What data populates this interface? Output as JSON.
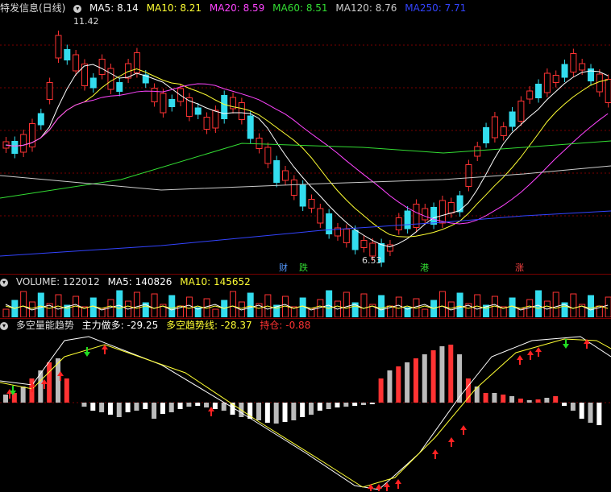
{
  "main": {
    "title": "特发信息(日线)",
    "ma": [
      {
        "label": "MA5: 8.14",
        "color": "#ffffff"
      },
      {
        "label": "MA10: 8.21",
        "color": "#ffff33"
      },
      {
        "label": "MA20: 8.59",
        "color": "#ff44ff"
      },
      {
        "label": "MA60: 8.51",
        "color": "#33dd33"
      },
      {
        "label": "MA120: 8.76",
        "color": "#cccccc"
      },
      {
        "label": "MA250: 7.71",
        "color": "#3344ff"
      }
    ],
    "high_label": "11.42",
    "low_label": "6.53",
    "tags": [
      {
        "text": "财",
        "color": "#5599ff"
      },
      {
        "text": "跌",
        "color": "#33dd33"
      },
      {
        "text": "港",
        "color": "#33dd33"
      },
      {
        "text": "涨",
        "color": "#ff4444"
      }
    ]
  },
  "volume": {
    "label": "VOLUME: 122012",
    "ma5": "MA5: 140826",
    "ma10": "MA10: 145652"
  },
  "indicator": {
    "title": "多空量能趋势",
    "main_force": "主力做多: -29.25",
    "trend_line": "多空趋势线: -28.37",
    "position": "持仓: -0.88"
  },
  "colors": {
    "up": "#ff3333",
    "down": "#33ddee",
    "grid": "#7a0000"
  }
}
